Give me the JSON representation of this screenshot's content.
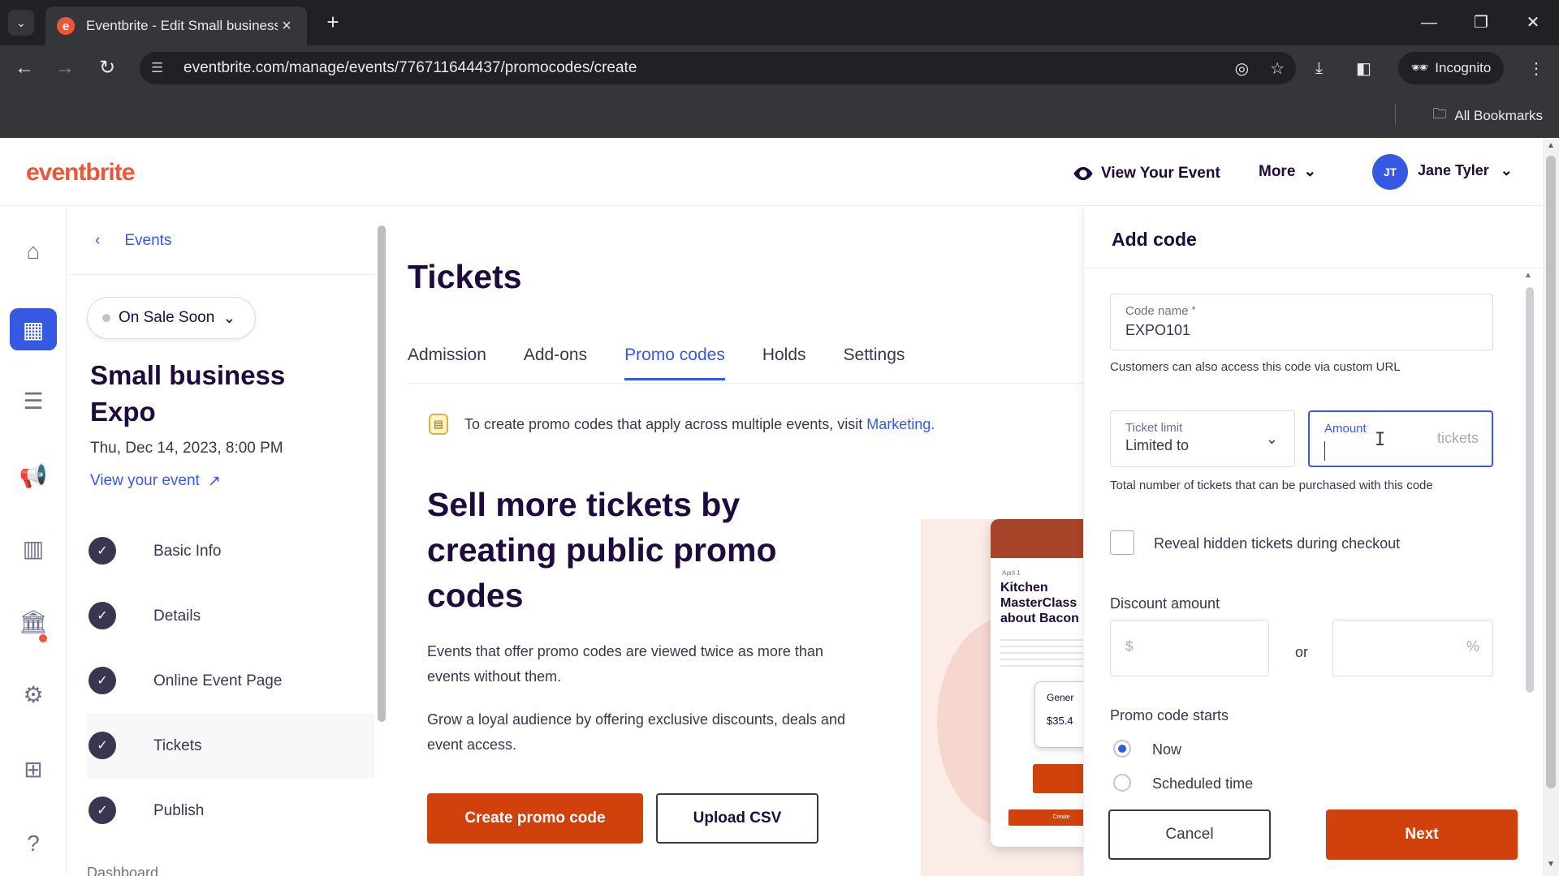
{
  "browser": {
    "tab_title": "Eventbrite - Edit Small business Expo",
    "url": "eventbrite.com/manage/events/776711644437/promocodes/create",
    "incognito_label": "Incognito",
    "bookmarks_label": "All Bookmarks"
  },
  "header": {
    "logo": "eventbrite",
    "view_event": "View Your Event",
    "more": "More",
    "user_initials": "JT",
    "user_name": "Jane Tyler"
  },
  "sidebar": {
    "back_label": "Events",
    "status": "On Sale Soon",
    "event_name": "Small business Expo",
    "event_date": "Thu, Dec 14, 2023, 8:00 PM",
    "view_event_link": "View your event",
    "steps": [
      {
        "label": "Basic Info"
      },
      {
        "label": "Details"
      },
      {
        "label": "Online Event Page"
      },
      {
        "label": "Tickets"
      },
      {
        "label": "Publish"
      }
    ],
    "more_label": "Dashboard"
  },
  "main": {
    "title": "Tickets",
    "tabs": [
      {
        "label": "Admission"
      },
      {
        "label": "Add-ons"
      },
      {
        "label": "Promo codes"
      },
      {
        "label": "Holds"
      },
      {
        "label": "Settings"
      }
    ],
    "active_tab": "Promo codes",
    "notice_text": "To create promo codes that apply across multiple events, visit",
    "notice_link": "Marketing.",
    "hero_title": "Sell more tickets by creating public promo codes",
    "hero_p1": "Events that offer promo codes are viewed twice as more than events without them.",
    "hero_p2": "Grow a loyal audience by offering exclusive discounts, deals and event access.",
    "create_button": "Create promo code",
    "upload_button": "Upload CSV",
    "illustration": {
      "date": "April 1",
      "title": "Kitchen MasterClass about Bacon",
      "ticket_name": "Gener",
      "ticket_price": "$35.4",
      "button_text": "Create"
    }
  },
  "drawer": {
    "title": "Add code",
    "code_name_label": "Code name",
    "code_name_value": "EXPO101",
    "code_name_helper": "Customers can also access this code via custom URL",
    "ticket_limit_label": "Ticket limit",
    "ticket_limit_value": "Limited to",
    "amount_label": "Amount",
    "amount_suffix": "tickets",
    "limit_helper": "Total number of tickets that can be purchased with this code",
    "reveal_label": "Reveal hidden tickets during checkout",
    "discount_label": "Discount amount",
    "currency_prefix": "$",
    "or_label": "or",
    "percent_suffix": "%",
    "starts_label": "Promo code starts",
    "start_now": "Now",
    "start_scheduled": "Scheduled time",
    "cancel_button": "Cancel",
    "next_button": "Next"
  },
  "colors": {
    "brand": "#f05537",
    "primary_button": "#d1410c",
    "link_blue": "#3659e3",
    "text_dark": "#1e0a3c"
  }
}
